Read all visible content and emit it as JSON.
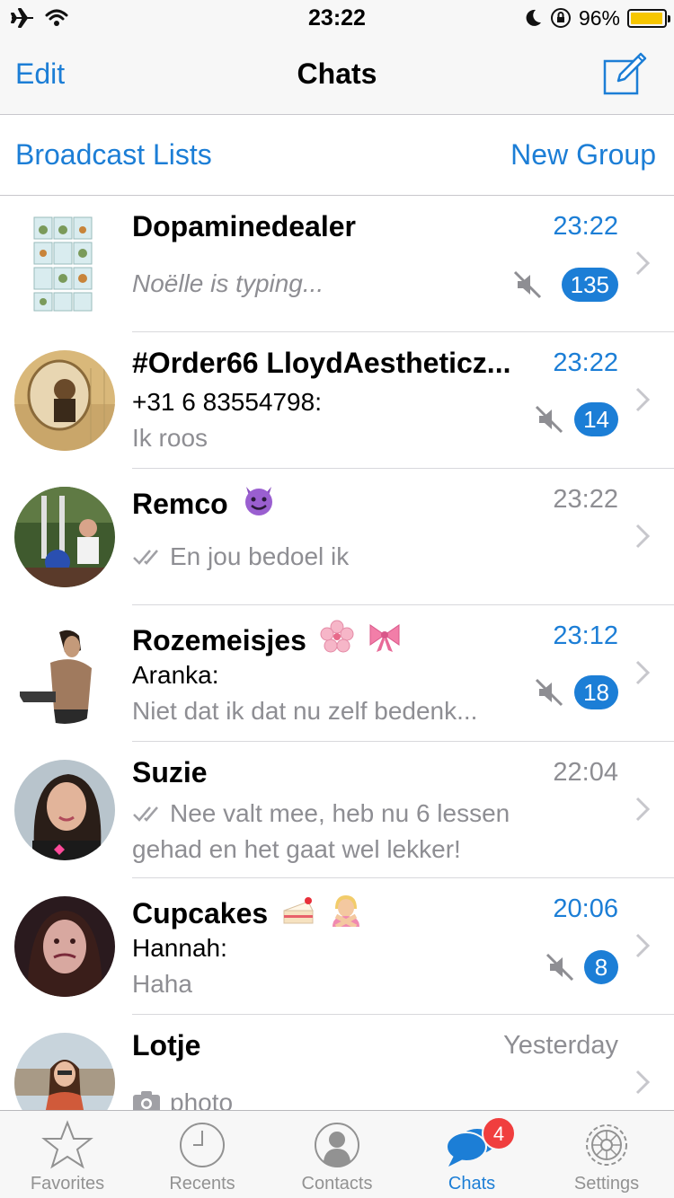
{
  "status_bar": {
    "time": "23:22",
    "battery_percent": "96%",
    "battery_level": 0.96
  },
  "nav": {
    "edit_label": "Edit",
    "title": "Chats"
  },
  "broadcast": {
    "left_label": "Broadcast Lists",
    "right_label": "New Group"
  },
  "chats": [
    {
      "name": "Dopaminedealer",
      "time": "23:22",
      "message": "Noëlle is typing...",
      "badge": "135"
    },
    {
      "name": "#Order66 LloydAestheticz...",
      "time": "23:22",
      "sender": "+31 6 83554798:",
      "message": "Ik roos",
      "badge": "14"
    },
    {
      "name": "Remco",
      "time": "23:22",
      "message": "En jou bedoel ik"
    },
    {
      "name": "Rozemeisjes",
      "time": "23:12",
      "sender": "Aranka:",
      "message": "Niet dat ik dat nu zelf bedenk...",
      "badge": "18"
    },
    {
      "name": "Suzie",
      "time": "22:04",
      "message": "Nee valt mee, heb nu 6 lessen gehad en het gaat wel lekker!"
    },
    {
      "name": "Cupcakes",
      "time": "20:06",
      "sender": "Hannah:",
      "message": "Haha",
      "badge": "8"
    },
    {
      "name": "Lotje",
      "time": "Yesterday",
      "message": "photo"
    }
  ],
  "tabs": [
    {
      "label": "Favorites"
    },
    {
      "label": "Recents"
    },
    {
      "label": "Contacts"
    },
    {
      "label": "Chats",
      "badge": "4"
    },
    {
      "label": "Settings"
    }
  ],
  "colors": {
    "accent": "#1c7ed6",
    "badge_red": "#f03e3e",
    "gray_text": "#8e8e93"
  }
}
